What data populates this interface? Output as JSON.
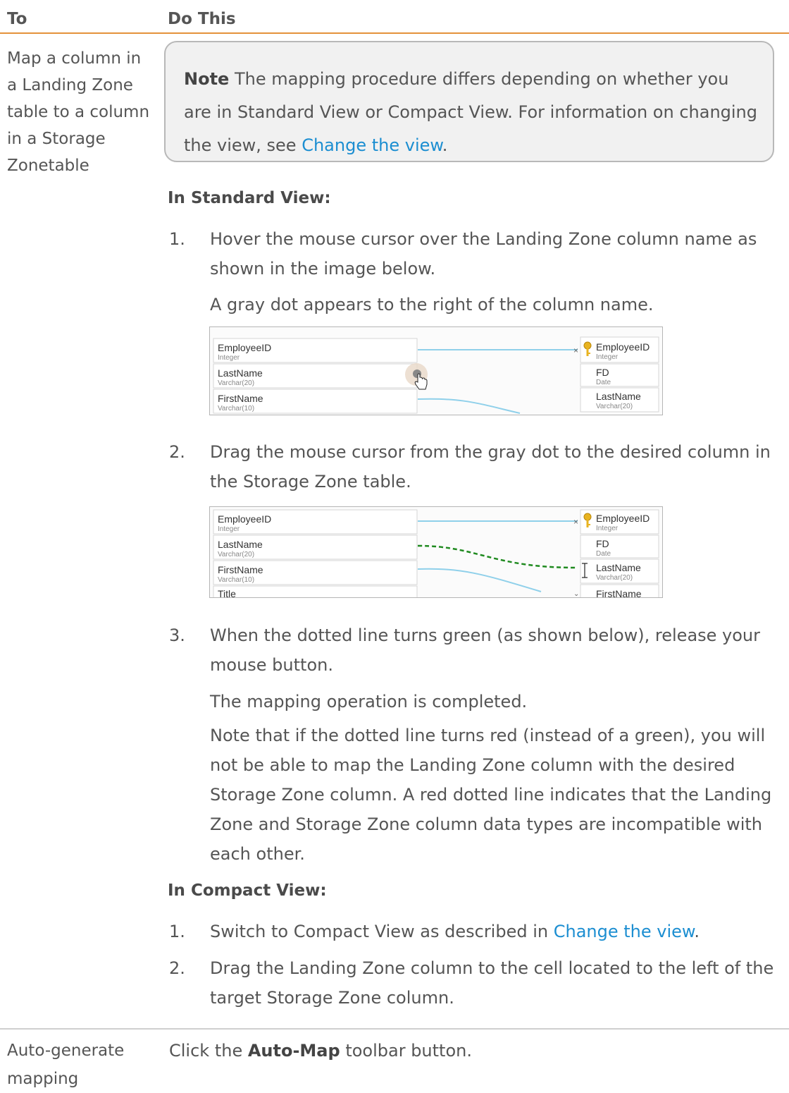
{
  "table": {
    "col_to": "To",
    "col_do_this": "Do This"
  },
  "row1": {
    "task": "Map a column in a Landing Zone table to a column in a Storage Zonetable",
    "note": {
      "label": "Note",
      "text": " The mapping procedure differs depending on whether you are in Standard View or Compact View. For information on changing the view, see ",
      "link": "Change the view",
      "end": "."
    },
    "standard_heading": "In Standard View:",
    "standard_steps": [
      {
        "num": "1.",
        "text": "Hover the mouse cursor over the Landing Zone column name as shown in the image below.",
        "followup": "A gray dot appears to the right of the column name."
      },
      {
        "num": "2.",
        "text": "Drag the mouse cursor from the gray dot to the desired column in the Storage Zone table."
      },
      {
        "num": "3.",
        "text": "When the dotted line turns green (as shown below), release your mouse button.",
        "followup": "The mapping operation is completed.",
        "followup2": "Note that if the dotted line turns red (instead of a green), you will not be able to map the Landing Zone column with the desired Storage Zone column. A red dotted line indicates that the Landing Zone and Storage Zone column data types are incompatible with each other."
      }
    ],
    "compact_heading": "In Compact View:",
    "compact_steps": [
      {
        "num": "1.",
        "text": "Switch to Compact View as described in ",
        "link": "Change the view",
        "end": "."
      },
      {
        "num": "2.",
        "text": "Drag the Landing Zone column to the cell located to the left of the target Storage Zone column."
      }
    ]
  },
  "screenshot1": {
    "left_columns": [
      {
        "name": "EmployeeID",
        "type": "Integer"
      },
      {
        "name": "LastName",
        "type": "Varchar(20)"
      },
      {
        "name": "FirstName",
        "type": "Varchar(10)"
      }
    ],
    "right_columns": [
      {
        "name": "EmployeeID",
        "type": "Integer"
      },
      {
        "name": "FD",
        "type": "Date"
      },
      {
        "name": "LastName",
        "type": "Varchar(20)"
      }
    ]
  },
  "screenshot2": {
    "left_columns": [
      {
        "name": "EmployeeID",
        "type": "Integer"
      },
      {
        "name": "LastName",
        "type": "Varchar(20)"
      },
      {
        "name": "FirstName",
        "type": "Varchar(10)"
      },
      {
        "name": "Title",
        "type": ""
      }
    ],
    "right_columns": [
      {
        "name": "EmployeeID",
        "type": "Integer"
      },
      {
        "name": "FD",
        "type": "Date"
      },
      {
        "name": "LastName",
        "type": "Varchar(20)"
      },
      {
        "name": "FirstName",
        "type": ""
      }
    ]
  },
  "row2": {
    "task": "Auto-generate mapping",
    "action_prefix": "Click the ",
    "action_bold": "Auto-Map",
    "action_suffix": " toolbar button."
  },
  "colors": {
    "accent_rule": "#e4923a",
    "link": "#1c8ed1",
    "mapping_line": "#8fd0ea",
    "dotted_green": "#1f8a1f",
    "key_icon": "#e8b320"
  }
}
